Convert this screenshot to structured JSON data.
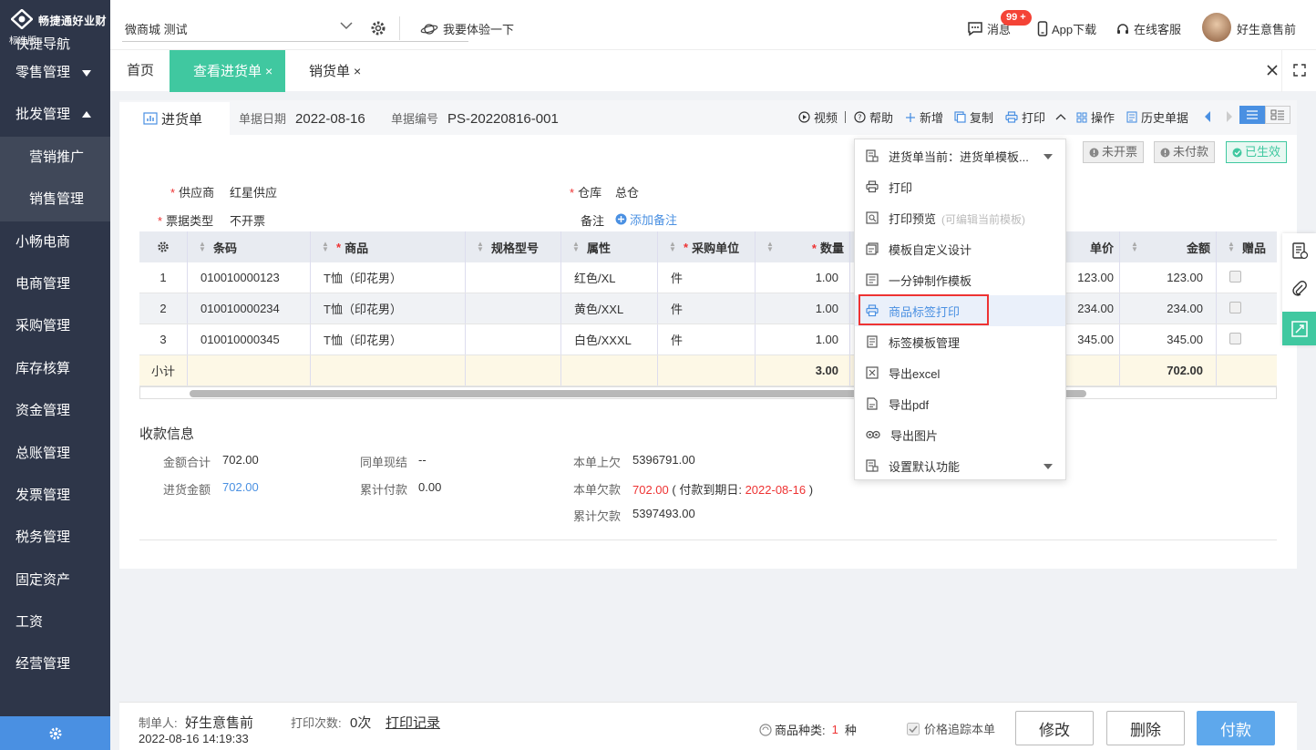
{
  "sidebar": {
    "brand": "畅捷通好业财",
    "edition": "标准版",
    "partial_item": "快捷导航",
    "items": [
      {
        "label": "零售管理",
        "caret": "down"
      },
      {
        "label": "批发管理",
        "caret": "up"
      }
    ],
    "sub_items": [
      "营销推广",
      "销售管理"
    ],
    "items_after": [
      "小畅电商",
      "电商管理",
      "采购管理",
      "库存核算",
      "资金管理",
      "总账管理",
      "发票管理",
      "税务管理",
      "固定资产",
      "工资",
      "经营管理"
    ]
  },
  "topbar": {
    "store": "微商城 测试",
    "try_label": "我要体验一下",
    "messages_label": "消息",
    "messages_badge": "99 +",
    "app_label": "App下载",
    "service_label": "在线客服",
    "user_name": "好生意售前"
  },
  "tabs": [
    {
      "label": "首页",
      "closable": false,
      "active": false
    },
    {
      "label": "查看进货单",
      "closable": true,
      "active": true
    },
    {
      "label": "销货单",
      "closable": true,
      "active": false
    }
  ],
  "tab_close": "×",
  "document": {
    "tab_label": "进货单",
    "date_label": "单据日期",
    "date_value": "2022-08-16",
    "number_label": "单据编号",
    "number_value": "PS-20220816-001",
    "tools": {
      "video": "视频",
      "help": "帮助",
      "add": "新增",
      "copy": "复制",
      "print": "打印",
      "operate": "操作",
      "history": "历史单据"
    },
    "status": {
      "not_invoiced": "未开票",
      "not_paid": "未付款",
      "effective": "已生效"
    },
    "fields": {
      "supplier_label": "供应商",
      "supplier_value": "红星供应",
      "warehouse_label": "仓库",
      "warehouse_value": "总仓",
      "ticket_type_label": "票据类型",
      "ticket_type_value": "不开票",
      "remark_label": "备注",
      "add_remark": "添加备注"
    }
  },
  "table": {
    "headers": {
      "barcode": "条码",
      "product": "商品",
      "spec": "规格型号",
      "attr": "属性",
      "unit": "采购单位",
      "qty": "数量",
      "price": "单价",
      "amount": "金额",
      "gift": "赠品"
    },
    "rows": [
      {
        "no": "1",
        "barcode": "010010000123",
        "product": "T恤（印花男）",
        "attr": "红色/XL",
        "unit": "件",
        "qty": "1.00",
        "price": "123.00",
        "amount": "123.00"
      },
      {
        "no": "2",
        "barcode": "010010000234",
        "product": "T恤（印花男）",
        "attr": "黄色/XXL",
        "unit": "件",
        "qty": "1.00",
        "price": "234.00",
        "amount": "234.00"
      },
      {
        "no": "3",
        "barcode": "010010000345",
        "product": "T恤（印花男）",
        "attr": "白色/XXXL",
        "unit": "件",
        "qty": "1.00",
        "price": "345.00",
        "amount": "345.00"
      }
    ],
    "subtotal": {
      "label": "小计",
      "qty": "3.00",
      "amount": "702.00"
    }
  },
  "payment": {
    "title": "收款信息",
    "total_label": "金额合计",
    "total_value": "702.00",
    "purchase_label": "进货金额",
    "purchase_value": "702.00",
    "cash_label": "同单现结",
    "cash_value": "--",
    "paid_label": "累计付款",
    "paid_value": "0.00",
    "prev_debt_label": "本单上欠",
    "prev_debt_value": "5396791.00",
    "debt_label": "本单欠款",
    "debt_value": "702.00",
    "debt_due_prefix": "( 付款到期日:",
    "debt_due_date": "2022-08-16",
    "debt_due_suffix": ")",
    "total_debt_label": "累计欠款",
    "total_debt_value": "5397493.00"
  },
  "dropdown": {
    "items": [
      {
        "label": "进货单当前：进货单模板...",
        "icon": "template-icon"
      },
      {
        "label": "打印",
        "icon": "printer-icon"
      },
      {
        "label": "打印预览",
        "hint": "(可编辑当前模板)",
        "icon": "preview-icon"
      },
      {
        "label": "模板自定义设计",
        "icon": "design-icon"
      },
      {
        "label": "一分钟制作模板",
        "icon": "quick-template-icon"
      },
      {
        "label": "商品标签打印",
        "icon": "label-print-icon"
      },
      {
        "label": "标签模板管理",
        "icon": "label-template-icon"
      },
      {
        "label": "导出excel",
        "icon": "export-excel-icon"
      },
      {
        "label": "导出pdf",
        "icon": "export-pdf-icon"
      },
      {
        "label": "导出图片",
        "icon": "export-image-icon"
      },
      {
        "label": "设置默认功能",
        "icon": "default-setting-icon"
      }
    ],
    "highlighted_index": 5
  },
  "bottombar": {
    "creator_label": "制单人:",
    "creator_value": "好生意售前",
    "created_time": "2022-08-16 14:19:33",
    "print_count_label": "打印次数:",
    "print_count_value": "0次",
    "print_record": "打印记录",
    "kinds_label": "商品种类:",
    "kinds_value": "1",
    "kinds_unit": "种",
    "track_label": "价格追踪本单",
    "edit": "修改",
    "delete": "删除",
    "pay": "付款"
  },
  "colors": {
    "sidebar_bg": "#2e3649",
    "accent_green": "#40c8a0",
    "accent_blue": "#4a90e2",
    "danger_red": "#e33333"
  }
}
